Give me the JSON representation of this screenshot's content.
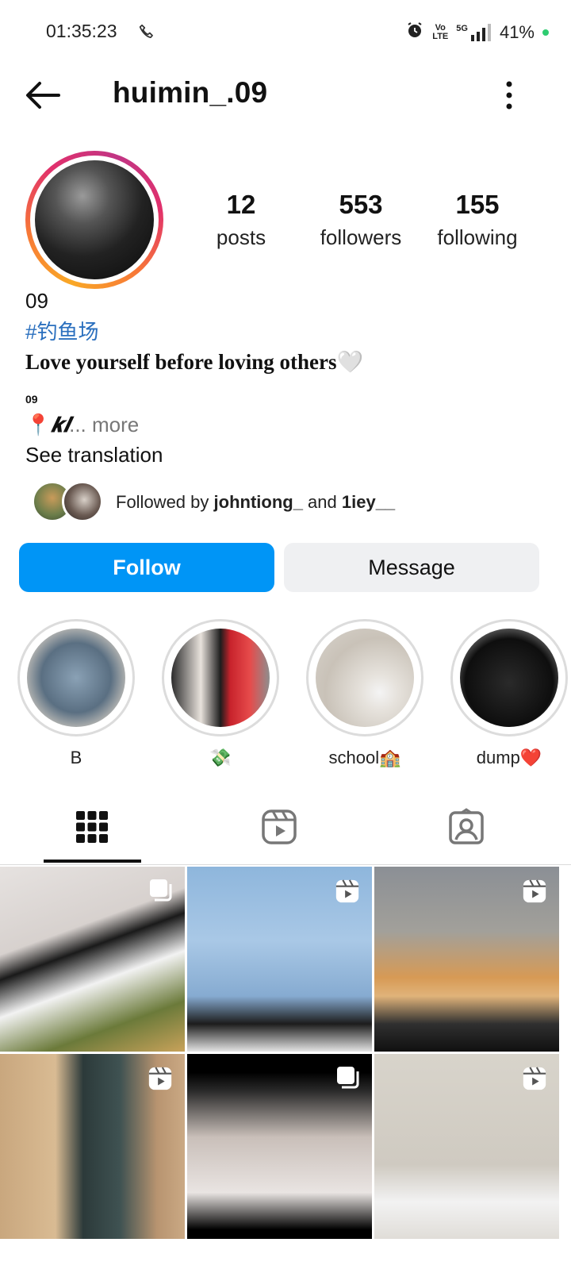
{
  "status": {
    "time": "01:35:23",
    "battery": "41%",
    "network": "5G"
  },
  "header": {
    "username": "huimin_.09"
  },
  "profile": {
    "stats": [
      {
        "value": "12",
        "label": "posts"
      },
      {
        "value": "553",
        "label": "followers"
      },
      {
        "value": "155",
        "label": "following"
      }
    ],
    "name": "09",
    "hashtag": "#钓鱼场",
    "bio_line": "Love yourself before loving others🤍",
    "bio_small": "09",
    "location_pin": "📍",
    "location_text": "𝒌𝒍",
    "more": "... more",
    "see_translation": "See translation",
    "followed_by": {
      "prefix": "Followed by ",
      "user1": "johntiong_",
      "joiner": " and ",
      "user2": "1iey__"
    }
  },
  "actions": {
    "follow": "Follow",
    "message": "Message"
  },
  "highlights": [
    {
      "label": "B"
    },
    {
      "label": "💸"
    },
    {
      "label": "school🏫"
    },
    {
      "label": "dump❤️"
    }
  ],
  "colors": {
    "accent": "#0095f6",
    "hashtag": "#2a6fbe",
    "secondary_button": "#eff0f2"
  }
}
